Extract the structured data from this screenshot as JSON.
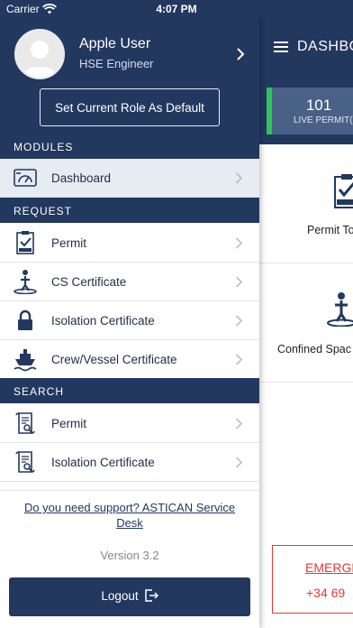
{
  "status_bar": {
    "carrier": "Carrier",
    "time": "4:07 PM"
  },
  "drawer": {
    "user": {
      "name": "Apple User",
      "role": "HSE Engineer"
    },
    "set_role_default_label": "Set Current Role As Default",
    "sections": {
      "modules": "MODULES",
      "request": "REQUEST",
      "search": "SEARCH"
    },
    "modules_items": [
      {
        "label": "Dashboard",
        "icon": "dashboard-icon"
      }
    ],
    "request_items": [
      {
        "label": "Permit",
        "icon": "permit-clipboard-icon"
      },
      {
        "label": "CS Certificate",
        "icon": "confined-space-icon"
      },
      {
        "label": "Isolation Certificate",
        "icon": "lock-icon"
      },
      {
        "label": "Crew/Vessel Certificate",
        "icon": "ship-icon"
      }
    ],
    "search_items": [
      {
        "label": "Permit",
        "icon": "scroll-search-icon"
      },
      {
        "label": "Isolation Certificate",
        "icon": "scroll-search-icon"
      }
    ],
    "support_link": "Do you need support? ASTICAN Service Desk",
    "version": "Version 3.2",
    "logout_label": "Logout"
  },
  "background_app": {
    "title": "DASHBO",
    "live_permits_count": "101",
    "live_permits_label": "LIVE PERMIT(S",
    "tiles": [
      {
        "label": "Permit To"
      },
      {
        "label": "Confined Spac"
      }
    ],
    "emergency_title": "EMERGE",
    "emergency_phone": "+34 69"
  },
  "colors": {
    "primary": "#22385f",
    "active_row": "#e7ecf3",
    "live_accent": "#2ec45a",
    "emergency": "#e53935"
  }
}
